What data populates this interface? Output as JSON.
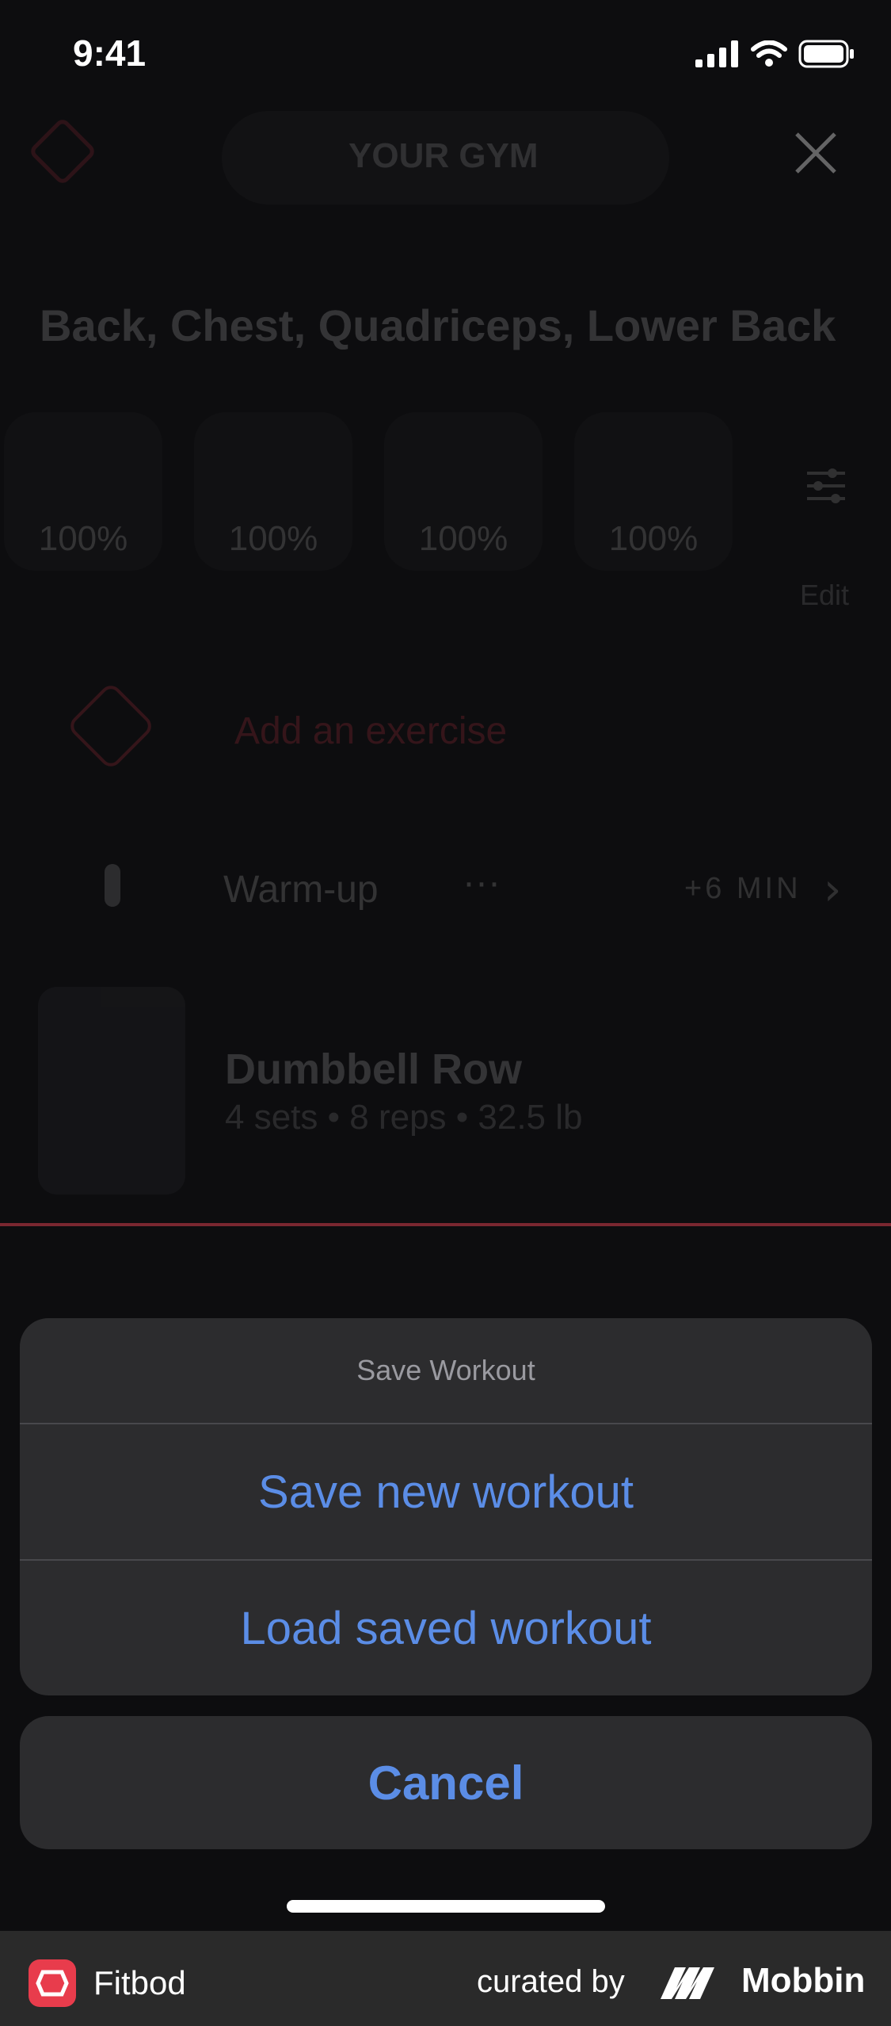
{
  "status_bar": {
    "time": "9:41",
    "signal_icon": "cellular-signal-icon",
    "wifi_icon": "wifi-icon",
    "battery_icon": "battery-icon"
  },
  "background": {
    "gym_label": "YOUR GYM",
    "muscles_title": "Back, Chest, Quadriceps, Lower Back",
    "muscle_recovery": [
      "100%",
      "100%",
      "100%",
      "100%"
    ],
    "edit_label": "Edit",
    "add_exercise_label": "Add an exercise",
    "warmup": {
      "label": "Warm-up",
      "dots": "···",
      "duration": "+6 MIN"
    },
    "exercise": {
      "name": "Dumbbell Row",
      "detail": "4 sets • 8 reps • 32.5 lb"
    }
  },
  "action_sheet": {
    "title": "Save Workout",
    "actions": [
      "Save new workout",
      "Load saved workout"
    ],
    "cancel_label": "Cancel"
  },
  "footer": {
    "app_name": "Fitbod",
    "curated_by": "curated by",
    "brand": "Mobbin"
  },
  "colors": {
    "accent_red": "#e83c4c",
    "action_blue": "#5b8de6",
    "sheet_bg": "#2c2c2e"
  }
}
